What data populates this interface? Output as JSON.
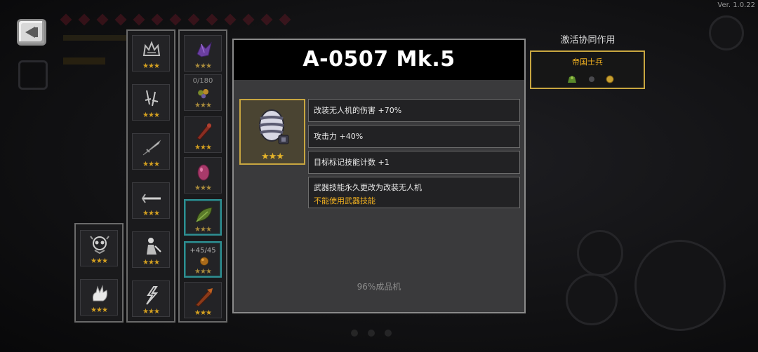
{
  "version": "Ver. 1.0.22",
  "colors": {
    "accent_gold": "#c8a640",
    "warning": "#f0b020",
    "star": "#d4a020",
    "teal_frame": "#2f8f92"
  },
  "back_button": {
    "icon": "back-arrow-icon"
  },
  "left_column": [
    {
      "icon": "ghost-skull-icon",
      "stars": "★★★"
    },
    {
      "icon": "spirit-hand-icon",
      "stars": "★★★"
    }
  ],
  "middle_column": [
    {
      "icon": "crest-emblem-icon",
      "stars": "★★★"
    },
    {
      "icon": "twin-sword-icon",
      "stars": "★★★"
    },
    {
      "icon": "blade-icon",
      "stars": "★★★"
    },
    {
      "icon": "arrow-staff-icon",
      "stars": "★★★"
    },
    {
      "icon": "warrior-figure-icon",
      "stars": "★★★"
    },
    {
      "icon": "lightning-figure-icon",
      "stars": "★★★"
    }
  ],
  "right_column": [
    {
      "icon": "purple-crystal-icon",
      "stars": "★★★",
      "count": ""
    },
    {
      "icon": "gem-cluster-icon",
      "stars": "★★★",
      "count": "0/180"
    },
    {
      "icon": "red-club-icon",
      "stars": "★★★",
      "count": ""
    },
    {
      "icon": "pink-egg-icon",
      "stars": "★★★",
      "count": ""
    },
    {
      "icon": "green-leaf-icon",
      "stars": "★★★",
      "count": ""
    },
    {
      "icon": "amber-orb-icon",
      "stars": "★★★",
      "count": "+45/45"
    },
    {
      "icon": "fire-blade-icon",
      "stars": "★★★",
      "count": ""
    }
  ],
  "detail": {
    "title": "A-0507 Mk.5",
    "item_icon": "striped-drone-icon",
    "item_stars": "★★★",
    "stats": [
      "改装无人机的伤害 +70%",
      "攻击力 +40%",
      "目标标记技能计数 +1"
    ],
    "special_stat": "武器技能永久更改为改装无人机",
    "special_warning": "不能使用武器技能",
    "footer": "96%成品机"
  },
  "synergy": {
    "heading": "激活协同作用",
    "name": "帝国士兵",
    "icons": [
      "green-soldier-icon",
      "gray-dot-icon",
      "gold-coin-icon"
    ]
  }
}
